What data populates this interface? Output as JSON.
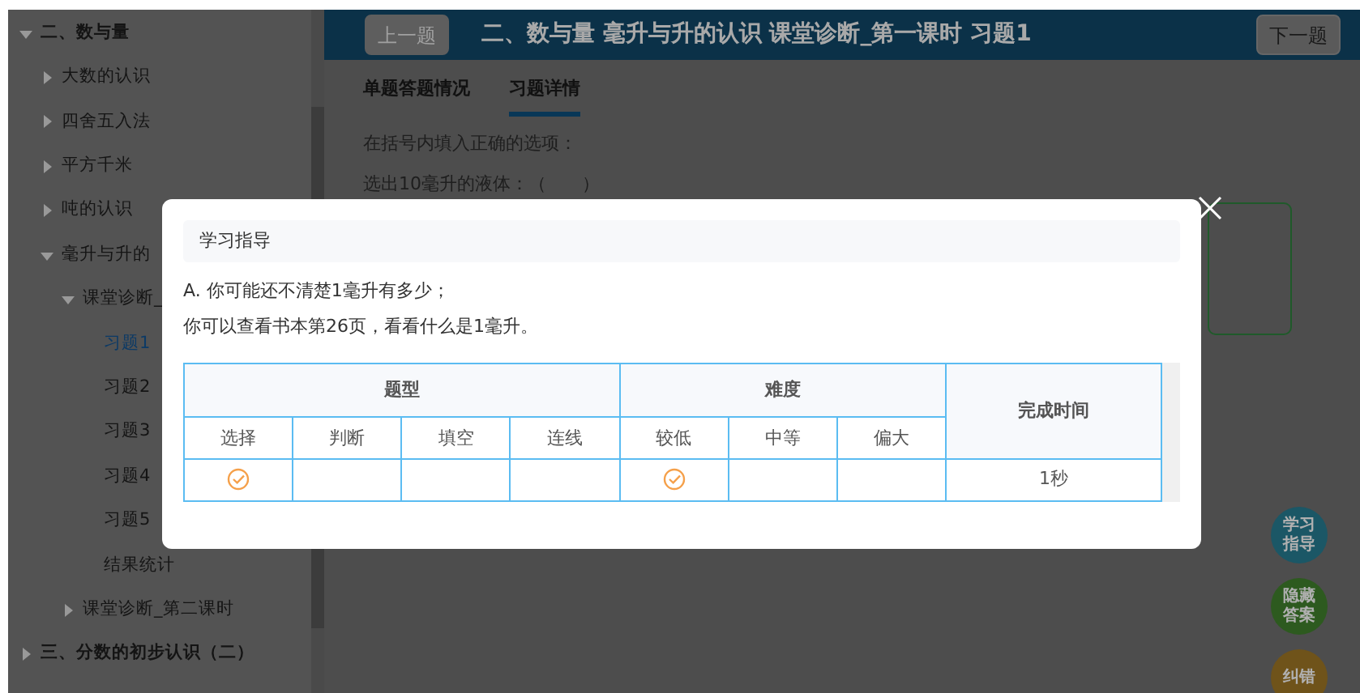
{
  "sidebar": {
    "items": [
      {
        "label": "二、数与量",
        "expanded": true,
        "selected": false,
        "children": [
          {
            "label": "大数的认识",
            "expanded": false,
            "selected": false
          },
          {
            "label": "四舍五入法",
            "expanded": false,
            "selected": false
          },
          {
            "label": "平方千米",
            "expanded": false,
            "selected": false
          },
          {
            "label": "吨的认识",
            "expanded": false,
            "selected": false
          },
          {
            "label": "毫升与升的",
            "expanded": true,
            "selected": false,
            "children": [
              {
                "label": "课堂诊断_",
                "expanded": true,
                "selected": false,
                "children": [
                  {
                    "label": "习题1",
                    "selected": true
                  },
                  {
                    "label": "习题2",
                    "selected": false
                  },
                  {
                    "label": "习题3",
                    "selected": false
                  },
                  {
                    "label": "习题4",
                    "selected": false
                  },
                  {
                    "label": "习题5",
                    "selected": false
                  },
                  {
                    "label": "结果统计",
                    "selected": false
                  }
                ]
              },
              {
                "label": "课堂诊断_第二课时",
                "expanded": false,
                "selected": false
              }
            ]
          }
        ]
      },
      {
        "label": "三、分数的初步认识（二）",
        "expanded": false,
        "selected": false
      }
    ]
  },
  "header": {
    "prev_button": {
      "label": "上一题",
      "disabled": true
    },
    "title": "二、数与量 毫升与升的认识 课堂诊断_第一课时 习题1",
    "next_button": {
      "label": "下一题",
      "disabled": false
    }
  },
  "tabs": [
    {
      "label": "单题答题情况",
      "selected": false
    },
    {
      "label": "习题详情",
      "selected": true
    }
  ],
  "question": [
    "在括号内填入正确的选项：",
    "选出10毫升的液体：（　　）"
  ],
  "float_buttons": [
    {
      "label": "学习指导",
      "color": "#1b5766"
    },
    {
      "label": "隐藏答案",
      "color": "#2d5a1f"
    },
    {
      "label": "纠错",
      "color": "#6f531a"
    }
  ],
  "modal": {
    "title": "学习指导",
    "lines": [
      "A. 你可能还不清楚1毫升有多少；",
      "你可以查看书本第26页，看看什么是1毫升。"
    ],
    "table": {
      "groups": [
        {
          "label": "题型",
          "columns": [
            "选择",
            "判断",
            "填空",
            "连线"
          ]
        },
        {
          "label": "难度",
          "columns": [
            "较低",
            "中等",
            "偏大"
          ]
        }
      ],
      "time_header": "完成时间",
      "row": {
        "marks": [
          {
            "checked": true
          },
          {
            "checked": false
          },
          {
            "checked": false
          },
          {
            "checked": false
          },
          {
            "checked": true
          },
          {
            "checked": false
          },
          {
            "checked": false
          }
        ],
        "time": "1秒"
      }
    }
  }
}
